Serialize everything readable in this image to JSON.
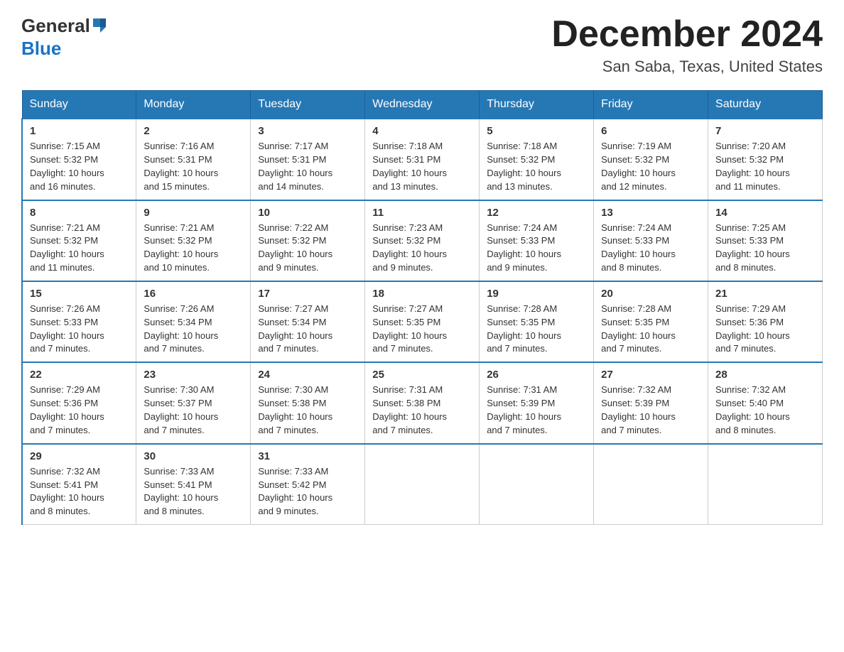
{
  "logo": {
    "general": "General",
    "blue": "Blue"
  },
  "title": "December 2024",
  "location": "San Saba, Texas, United States",
  "days_of_week": [
    "Sunday",
    "Monday",
    "Tuesday",
    "Wednesday",
    "Thursday",
    "Friday",
    "Saturday"
  ],
  "weeks": [
    [
      {
        "day": "1",
        "sunrise": "7:15 AM",
        "sunset": "5:32 PM",
        "daylight": "10 hours and 16 minutes."
      },
      {
        "day": "2",
        "sunrise": "7:16 AM",
        "sunset": "5:31 PM",
        "daylight": "10 hours and 15 minutes."
      },
      {
        "day": "3",
        "sunrise": "7:17 AM",
        "sunset": "5:31 PM",
        "daylight": "10 hours and 14 minutes."
      },
      {
        "day": "4",
        "sunrise": "7:18 AM",
        "sunset": "5:31 PM",
        "daylight": "10 hours and 13 minutes."
      },
      {
        "day": "5",
        "sunrise": "7:18 AM",
        "sunset": "5:32 PM",
        "daylight": "10 hours and 13 minutes."
      },
      {
        "day": "6",
        "sunrise": "7:19 AM",
        "sunset": "5:32 PM",
        "daylight": "10 hours and 12 minutes."
      },
      {
        "day": "7",
        "sunrise": "7:20 AM",
        "sunset": "5:32 PM",
        "daylight": "10 hours and 11 minutes."
      }
    ],
    [
      {
        "day": "8",
        "sunrise": "7:21 AM",
        "sunset": "5:32 PM",
        "daylight": "10 hours and 11 minutes."
      },
      {
        "day": "9",
        "sunrise": "7:21 AM",
        "sunset": "5:32 PM",
        "daylight": "10 hours and 10 minutes."
      },
      {
        "day": "10",
        "sunrise": "7:22 AM",
        "sunset": "5:32 PM",
        "daylight": "10 hours and 9 minutes."
      },
      {
        "day": "11",
        "sunrise": "7:23 AM",
        "sunset": "5:32 PM",
        "daylight": "10 hours and 9 minutes."
      },
      {
        "day": "12",
        "sunrise": "7:24 AM",
        "sunset": "5:33 PM",
        "daylight": "10 hours and 9 minutes."
      },
      {
        "day": "13",
        "sunrise": "7:24 AM",
        "sunset": "5:33 PM",
        "daylight": "10 hours and 8 minutes."
      },
      {
        "day": "14",
        "sunrise": "7:25 AM",
        "sunset": "5:33 PM",
        "daylight": "10 hours and 8 minutes."
      }
    ],
    [
      {
        "day": "15",
        "sunrise": "7:26 AM",
        "sunset": "5:33 PM",
        "daylight": "10 hours and 7 minutes."
      },
      {
        "day": "16",
        "sunrise": "7:26 AM",
        "sunset": "5:34 PM",
        "daylight": "10 hours and 7 minutes."
      },
      {
        "day": "17",
        "sunrise": "7:27 AM",
        "sunset": "5:34 PM",
        "daylight": "10 hours and 7 minutes."
      },
      {
        "day": "18",
        "sunrise": "7:27 AM",
        "sunset": "5:35 PM",
        "daylight": "10 hours and 7 minutes."
      },
      {
        "day": "19",
        "sunrise": "7:28 AM",
        "sunset": "5:35 PM",
        "daylight": "10 hours and 7 minutes."
      },
      {
        "day": "20",
        "sunrise": "7:28 AM",
        "sunset": "5:35 PM",
        "daylight": "10 hours and 7 minutes."
      },
      {
        "day": "21",
        "sunrise": "7:29 AM",
        "sunset": "5:36 PM",
        "daylight": "10 hours and 7 minutes."
      }
    ],
    [
      {
        "day": "22",
        "sunrise": "7:29 AM",
        "sunset": "5:36 PM",
        "daylight": "10 hours and 7 minutes."
      },
      {
        "day": "23",
        "sunrise": "7:30 AM",
        "sunset": "5:37 PM",
        "daylight": "10 hours and 7 minutes."
      },
      {
        "day": "24",
        "sunrise": "7:30 AM",
        "sunset": "5:38 PM",
        "daylight": "10 hours and 7 minutes."
      },
      {
        "day": "25",
        "sunrise": "7:31 AM",
        "sunset": "5:38 PM",
        "daylight": "10 hours and 7 minutes."
      },
      {
        "day": "26",
        "sunrise": "7:31 AM",
        "sunset": "5:39 PM",
        "daylight": "10 hours and 7 minutes."
      },
      {
        "day": "27",
        "sunrise": "7:32 AM",
        "sunset": "5:39 PM",
        "daylight": "10 hours and 7 minutes."
      },
      {
        "day": "28",
        "sunrise": "7:32 AM",
        "sunset": "5:40 PM",
        "daylight": "10 hours and 8 minutes."
      }
    ],
    [
      {
        "day": "29",
        "sunrise": "7:32 AM",
        "sunset": "5:41 PM",
        "daylight": "10 hours and 8 minutes."
      },
      {
        "day": "30",
        "sunrise": "7:33 AM",
        "sunset": "5:41 PM",
        "daylight": "10 hours and 8 minutes."
      },
      {
        "day": "31",
        "sunrise": "7:33 AM",
        "sunset": "5:42 PM",
        "daylight": "10 hours and 9 minutes."
      },
      null,
      null,
      null,
      null
    ]
  ],
  "labels": {
    "sunrise": "Sunrise: ",
    "sunset": "Sunset: ",
    "daylight": "Daylight: "
  }
}
